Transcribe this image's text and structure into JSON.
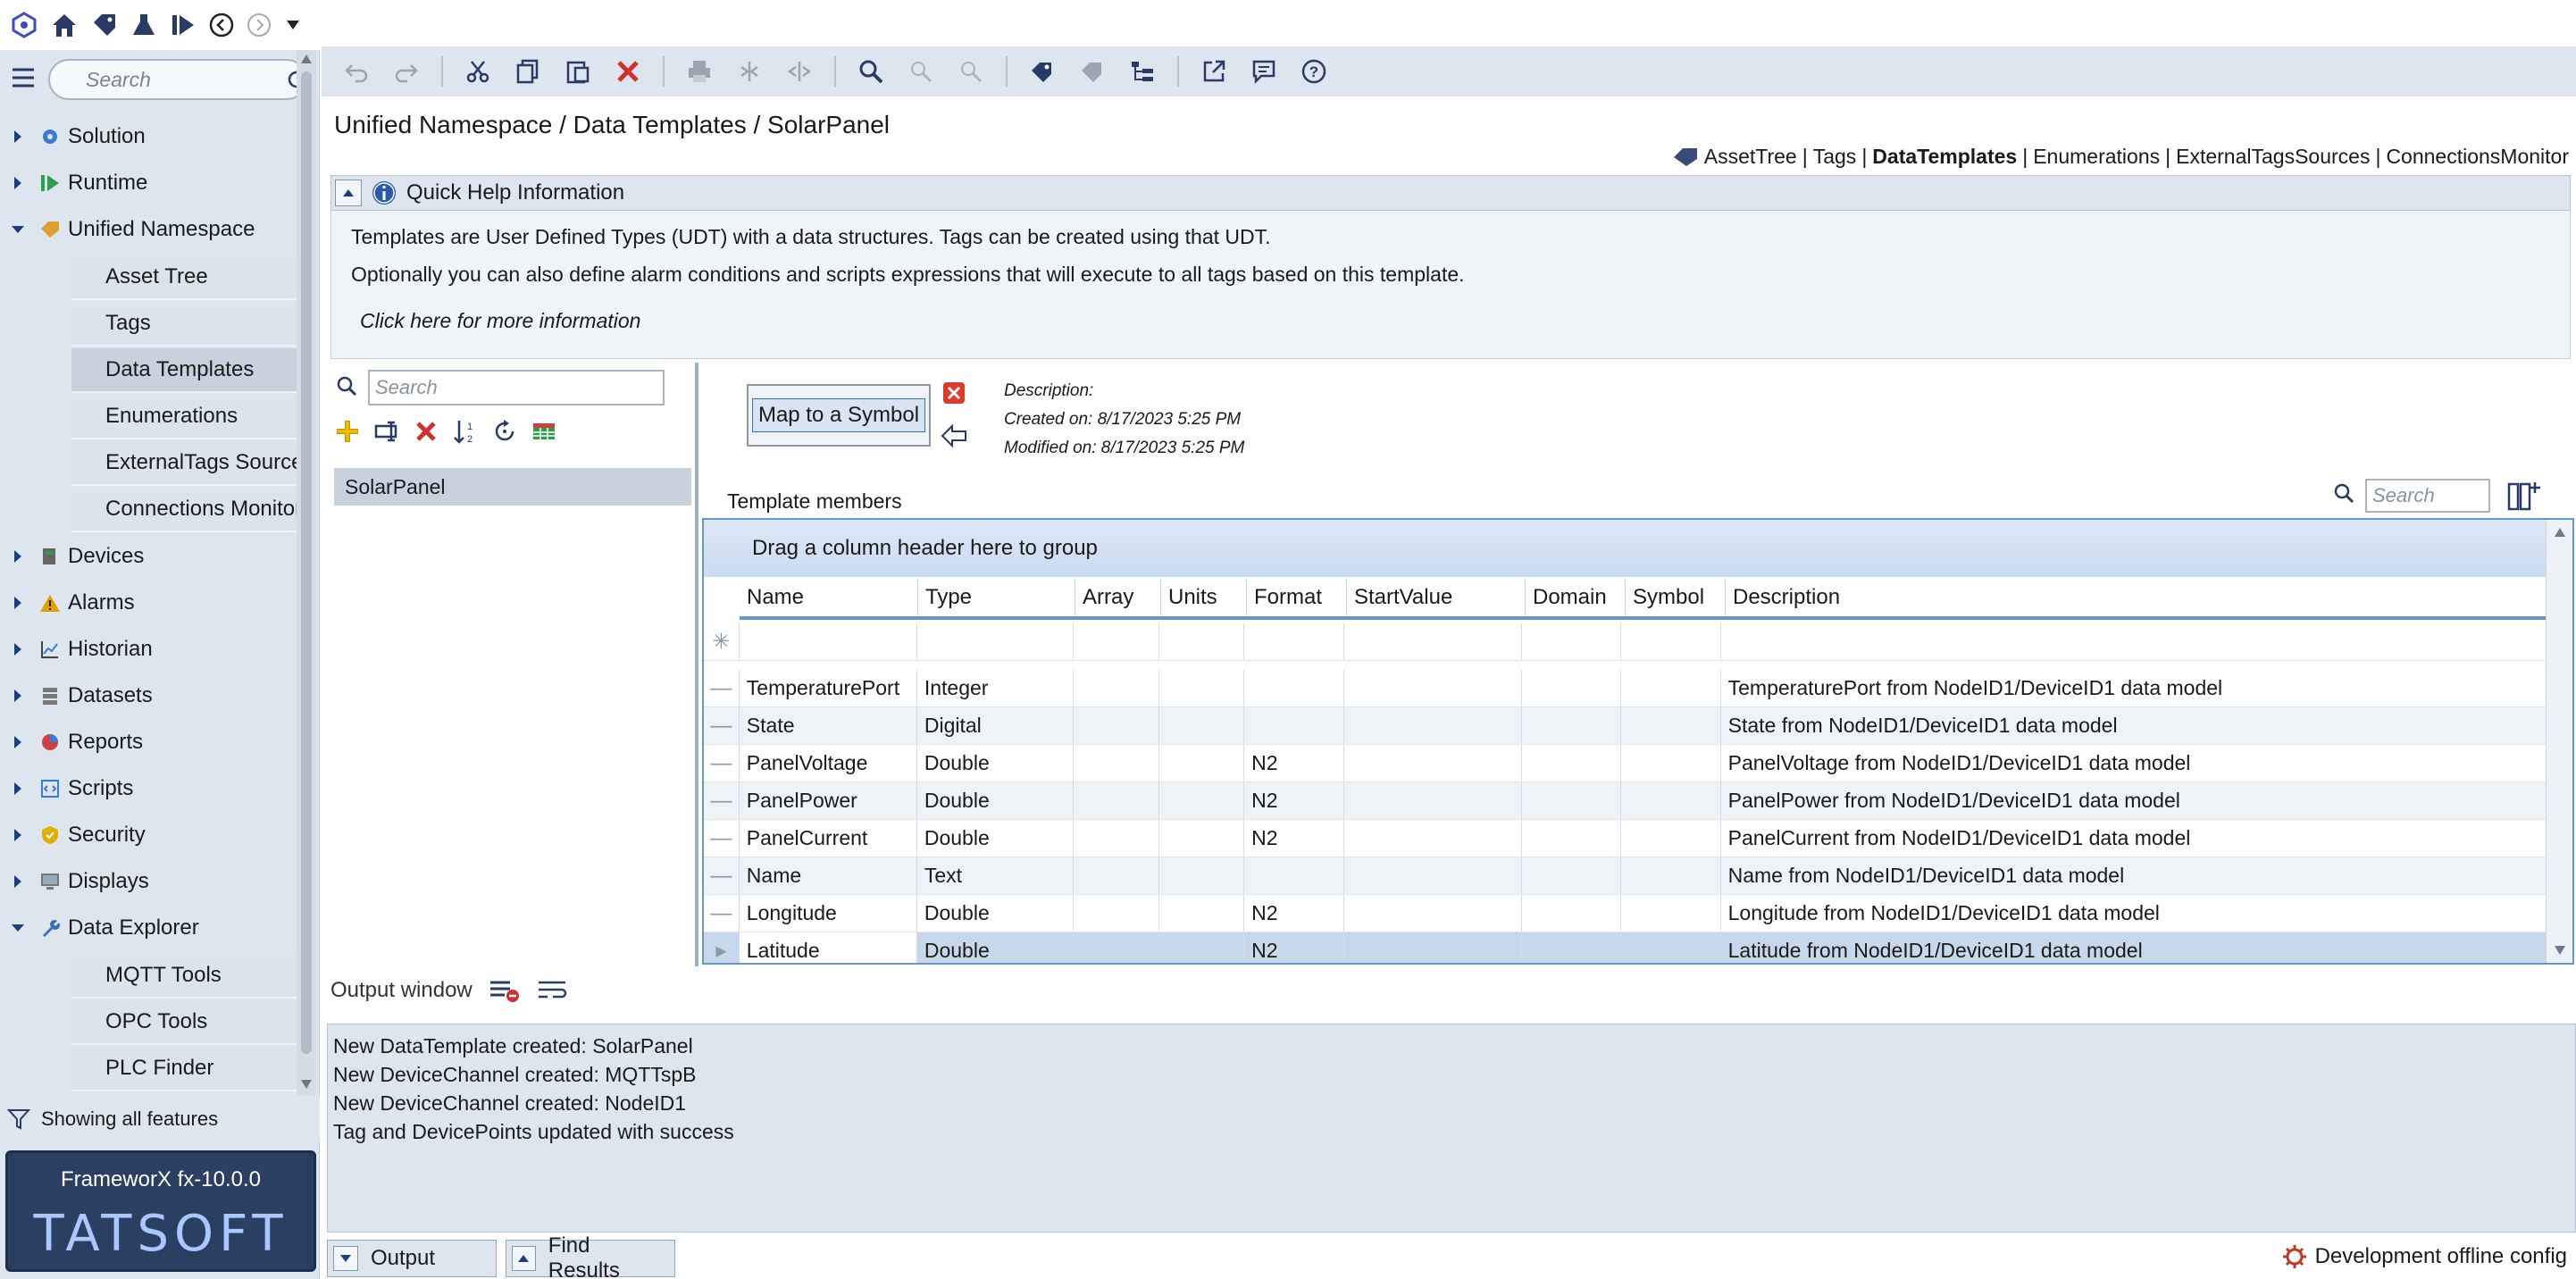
{
  "nav": {
    "search_placeholder": "Search",
    "items": [
      {
        "label": "Solution",
        "icon": "gear-icon",
        "color": "#3a7bd5"
      },
      {
        "label": "Runtime",
        "icon": "runtime-icon",
        "color": "#2e9e4a"
      },
      {
        "label": "Unified Namespace",
        "icon": "namespace-icon",
        "color": "#e0a030"
      },
      {
        "label": "Devices",
        "icon": "devices-icon",
        "color": "#666666"
      },
      {
        "label": "Alarms",
        "icon": "alarm-icon",
        "color": "#e0a000"
      },
      {
        "label": "Historian",
        "icon": "historian-icon",
        "color": "#3a7bd5"
      },
      {
        "label": "Datasets",
        "icon": "datasets-icon",
        "color": "#666666"
      },
      {
        "label": "Reports",
        "icon": "reports-icon",
        "color": "#d04040"
      },
      {
        "label": "Scripts",
        "icon": "scripts-icon",
        "color": "#3a7bd5"
      },
      {
        "label": "Security",
        "icon": "shield-icon",
        "color": "#e0b000"
      },
      {
        "label": "Displays",
        "icon": "displays-icon",
        "color": "#666666"
      },
      {
        "label": "Data Explorer",
        "icon": "wrench-icon",
        "color": "#3a6fb0"
      }
    ],
    "uns_children": [
      "Asset Tree",
      "Tags",
      "Data Templates",
      "Enumerations",
      "ExternalTags Sources",
      "Connections Monitor"
    ],
    "explorer_children": [
      "MQTT Tools",
      "OPC Tools",
      "PLC Finder"
    ],
    "filter_label": "Showing all features",
    "version": "FrameworX fx-10.0.0",
    "logo": "TATSOFT"
  },
  "breadcrumb": "Unified Namespace / Data Templates / SolarPanel",
  "quick_links": {
    "items": [
      "AssetTree",
      "Tags",
      "DataTemplates",
      "Enumerations",
      "ExternalTagsSources",
      "ConnectionsMonitor"
    ],
    "separator": "|"
  },
  "help": {
    "title": "Quick Help Information",
    "line1": "Templates are User Defined Types (UDT) with a data structures. Tags can be created using that UDT.",
    "line2": "Optionally you can also define alarm conditions and scripts expressions that will execute to all tags based on this template.",
    "link": "Click here for more information"
  },
  "templates": {
    "search_placeholder": "Search",
    "items": [
      "SolarPanel"
    ]
  },
  "detail": {
    "map_button": "Map to a Symbol",
    "description_label": "Description:",
    "created": "Created on: 8/17/2023 5:25 PM",
    "modified": "Modified on: 8/17/2023 5:25 PM",
    "members_label": "Template members",
    "search_placeholder": "Search"
  },
  "grid": {
    "group_hint": "Drag a column header here to group",
    "columns": [
      "Name",
      "Type",
      "Array",
      "Units",
      "Format",
      "StartValue",
      "Domain",
      "Symbol",
      "Description"
    ],
    "rows": [
      [
        "TemperaturePort",
        "Integer",
        "",
        "",
        "",
        "",
        "",
        "",
        "TemperaturePort from NodeID1/DeviceID1 data model"
      ],
      [
        "State",
        "Digital",
        "",
        "",
        "",
        "",
        "",
        "",
        "State from NodeID1/DeviceID1 data model"
      ],
      [
        "PanelVoltage",
        "Double",
        "",
        "",
        "N2",
        "",
        "",
        "",
        "PanelVoltage from NodeID1/DeviceID1 data model"
      ],
      [
        "PanelPower",
        "Double",
        "",
        "",
        "N2",
        "",
        "",
        "",
        "PanelPower from NodeID1/DeviceID1 data model"
      ],
      [
        "PanelCurrent",
        "Double",
        "",
        "",
        "N2",
        "",
        "",
        "",
        "PanelCurrent from NodeID1/DeviceID1 data model"
      ],
      [
        "Name",
        "Text",
        "",
        "",
        "",
        "",
        "",
        "",
        "Name from NodeID1/DeviceID1 data model"
      ],
      [
        "Longitude",
        "Double",
        "",
        "",
        "N2",
        "",
        "",
        "",
        "Longitude from NodeID1/DeviceID1 data model"
      ],
      [
        "Latitude",
        "Double",
        "",
        "",
        "N2",
        "",
        "",
        "",
        "Latitude from NodeID1/DeviceID1 data model"
      ]
    ]
  },
  "output": {
    "title": "Output window",
    "lines": [
      "New DataTemplate created: SolarPanel",
      "New DeviceChannel created: MQTTspB",
      "New DeviceChannel created: NodeID1",
      "Tag and DevicePoints updated with success"
    ]
  },
  "tabs": {
    "output": "Output",
    "find": "Find Results"
  },
  "status": "Development offline config",
  "colors": {
    "accent": "#3a6fb0",
    "panel": "#dde6ee",
    "selected_row": "#c7d8ec",
    "delete_red": "#d03030"
  }
}
